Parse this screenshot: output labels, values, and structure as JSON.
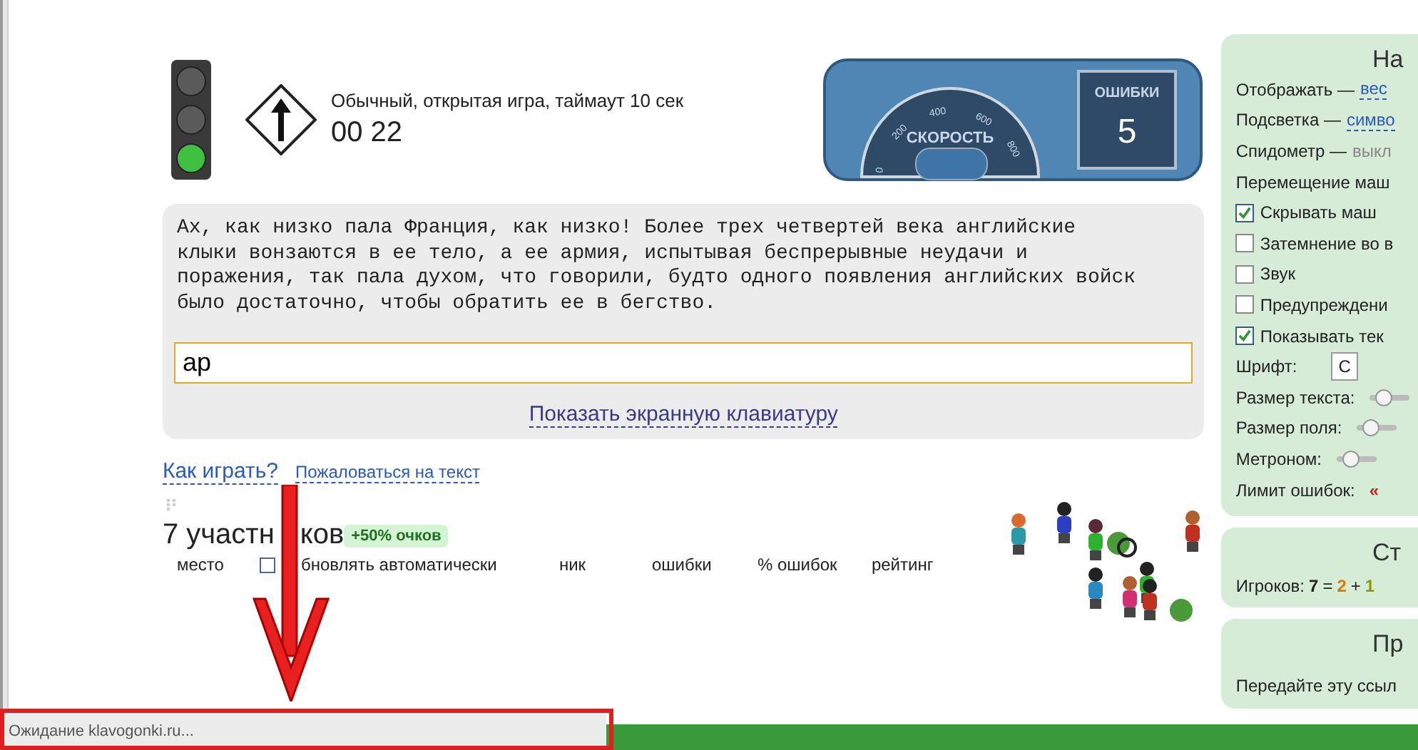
{
  "race": {
    "lights": [
      {
        "on": false
      },
      {
        "on": false
      },
      {
        "on": true
      }
    ],
    "status": "Обычный, открытая игра, таймаут 10 сек",
    "timer": "00 22"
  },
  "dashboard": {
    "speed_label": "СКОРОСТЬ",
    "scale": [
      "0",
      "200",
      "400",
      "600",
      "800"
    ],
    "errors_label": "ОШИБКИ",
    "errors": "5"
  },
  "text_lines": [
    "Ах, как низко пала Франция, как низко! Более трех четвертей века английские",
    "клыки вонзаются в ее тело, а ее армия, испытывая беспрерывные неудачи и",
    "поражения, так пала духом, что говорили, будто одного появления английских войск",
    "было достаточно, чтобы обратить ее в бегство."
  ],
  "input": {
    "value": "ар"
  },
  "keyboard_link": "Показать экранную клавиатуру",
  "help_links": [
    "Как играть?",
    "Пожаловаться на текст"
  ],
  "participants": {
    "title_parts": [
      "7 участн",
      "ков"
    ],
    "bonus": "+50% очков",
    "auto_update": {
      "label": "бновлять автоматически",
      "checked": false
    },
    "columns": [
      "место",
      "ник",
      "ошибки",
      "% ошибок",
      "рейтинг"
    ]
  },
  "settings": {
    "title": "На",
    "rows": [
      {
        "kind": "choice",
        "label": "Отображать —",
        "value": "вес",
        "muted": false
      },
      {
        "kind": "choice",
        "label": "Подсветка —",
        "value": "симво",
        "muted": false
      },
      {
        "kind": "choice",
        "label": "Спидометр —",
        "value": "выкл",
        "muted": true
      },
      {
        "kind": "text",
        "label": "Перемещение маш"
      },
      {
        "kind": "checkbox",
        "label": "Скрывать маш",
        "checked": true
      },
      {
        "kind": "checkbox",
        "label": "Затемнение во в",
        "checked": false
      },
      {
        "kind": "checkbox",
        "label": "Звук",
        "checked": false
      },
      {
        "kind": "checkbox",
        "label": "Предупреждени",
        "checked": false
      },
      {
        "kind": "checkbox",
        "label": "Показывать тек",
        "checked": true
      },
      {
        "kind": "select",
        "label": "Шрифт:",
        "value": "С"
      },
      {
        "kind": "slider",
        "label": "Размер текста:"
      },
      {
        "kind": "slider",
        "label": "Размер поля:"
      },
      {
        "kind": "slider",
        "label": "Метроном:"
      },
      {
        "kind": "limit",
        "label": "Лимит ошибок:",
        "value": "«"
      }
    ]
  },
  "stats": {
    "title": "Ст",
    "parts": [
      {
        "text": "Игроков:",
        "color": "#222222",
        "bold": false
      },
      {
        "text": "7",
        "color": "#222222",
        "bold": true
      },
      {
        "text": "=",
        "color": "#222222",
        "bold": false
      },
      {
        "text": "2",
        "color": "#e07800",
        "bold": true
      },
      {
        "text": "+",
        "color": "#222222",
        "bold": false
      },
      {
        "text": "1",
        "color": "#8a9a00",
        "bold": true
      }
    ]
  },
  "share": {
    "title": "Пр",
    "text": "Передайте эту ссыл"
  },
  "status_bar": "Ожидание klavogonki.ru..."
}
